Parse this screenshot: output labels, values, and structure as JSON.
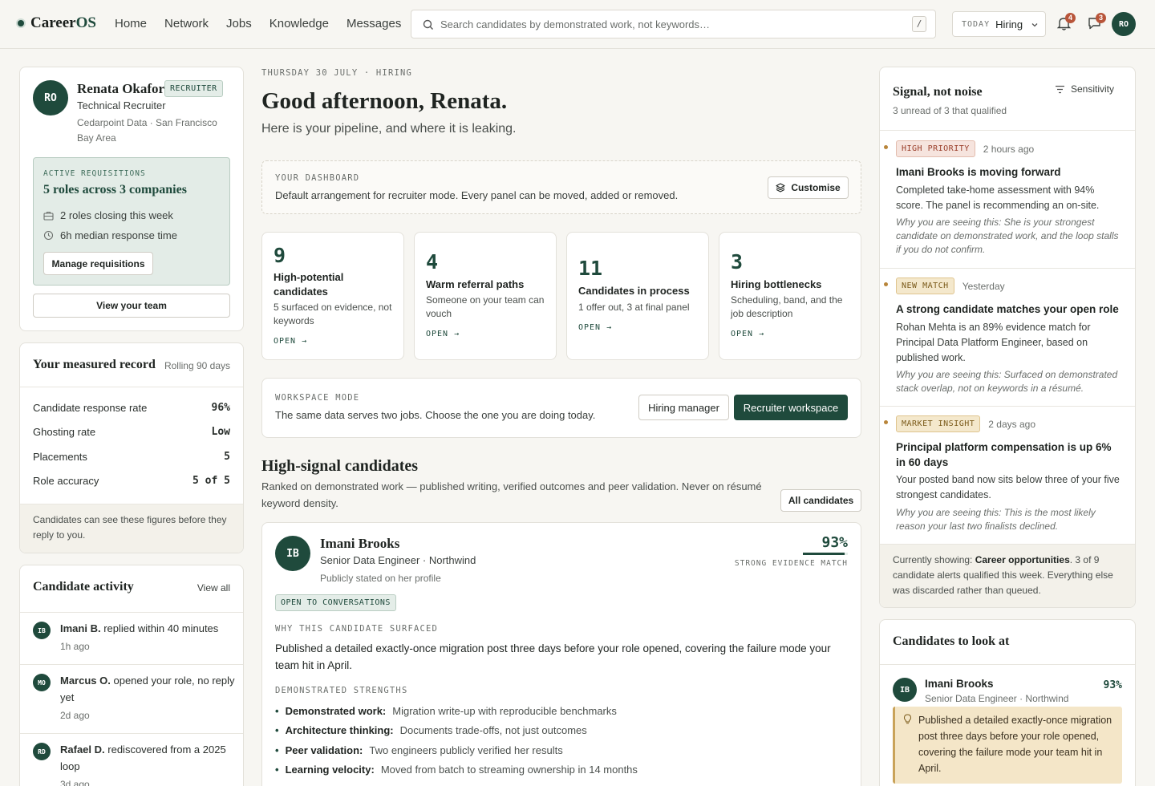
{
  "nav": {
    "logo_a": "Career",
    "logo_b": "OS",
    "links": [
      "Home",
      "Network",
      "Jobs",
      "Knowledge",
      "Messages"
    ],
    "search_placeholder": "Search candidates by demonstrated work, not keywords…",
    "search_shortcut": "/",
    "mode_label": "TODAY",
    "mode_value": "Hiring",
    "notifications_count": "4",
    "messages_count": "3",
    "user_initials": "RO"
  },
  "profile": {
    "initials": "RO",
    "name": "Renata Okafor",
    "tag": "RECRUITER",
    "role": "Technical Recruiter",
    "location": "Cedarpoint Data · San Francisco Bay Area",
    "req_label": "ACTIVE REQUISITIONS",
    "req_title": "5 roles across 3 companies",
    "req_closing": "2 roles closing this week",
    "req_response": "6h median response time",
    "manage_btn": "Manage requisitions",
    "team_btn": "View your team"
  },
  "record": {
    "title": "Your measured record",
    "period": "Rolling 90 days",
    "rows": [
      {
        "label": "Candidate response rate",
        "value": "96%"
      },
      {
        "label": "Ghosting rate",
        "value": "Low"
      },
      {
        "label": "Placements",
        "value": "5"
      },
      {
        "label": "Role accuracy",
        "value": "5 of 5"
      }
    ],
    "footnote": "Candidates can see these figures before they reply to you."
  },
  "activity": {
    "title": "Candidate activity",
    "view_all": "View all",
    "items": [
      {
        "initials": "IB",
        "name": "Imani B.",
        "text": "replied within 40 minutes",
        "time": "1h ago"
      },
      {
        "initials": "MO",
        "name": "Marcus O.",
        "text": "opened your role, no reply yet",
        "time": "2d ago"
      },
      {
        "initials": "RD",
        "name": "Rafael D.",
        "text": "rediscovered from a 2025 loop",
        "time": "3d ago"
      }
    ]
  },
  "main": {
    "kicker": "THURSDAY 30 JULY · HIRING",
    "greeting": "Good afternoon, Renata.",
    "subtitle": "Here is your pipeline, and where it is leaking.",
    "dashboard_label": "YOUR DASHBOARD",
    "dashboard_text": "Default arrangement for recruiter mode. Every panel can be moved, added or removed.",
    "customise_btn": "Customise",
    "stats": [
      {
        "num": "9",
        "title": "High-potential candidates",
        "desc": "5 surfaced on evidence, not keywords",
        "open": "OPEN →"
      },
      {
        "num": "4",
        "title": "Warm referral paths",
        "desc": "Someone on your team can vouch",
        "open": "OPEN →"
      },
      {
        "num": "11",
        "title": "Candidates in process",
        "desc": "1 offer out, 3 at final panel",
        "open": "OPEN →"
      },
      {
        "num": "3",
        "title": "Hiring bottlenecks",
        "desc": "Scheduling, band, and the job description",
        "open": "OPEN →"
      }
    ],
    "workspace_label": "WORKSPACE MODE",
    "workspace_text": "The same data serves two jobs. Choose the one you are doing today.",
    "hm_btn": "Hiring manager",
    "rw_btn": "Recruiter workspace",
    "hs_title": "High-signal candidates",
    "hs_sub": "Ranked on demonstrated work — published writing, verified outcomes and peer validation. Never on résumé keyword density.",
    "all_btn": "All candidates",
    "candidate": {
      "initials": "IB",
      "name": "Imani Brooks",
      "role": "Senior Data Engineer · Northwind",
      "note": "Publicly stated on her profile",
      "score": "93%",
      "score_value": 0.93,
      "score_label": "STRONG EVIDENCE MATCH",
      "status": "OPEN TO CONVERSATIONS",
      "why_label": "WHY THIS CANDIDATE SURFACED",
      "why_text": "Published a detailed exactly-once migration post three days before your role opened, covering the failure mode your team hit in April.",
      "strengths_label": "DEMONSTRATED STRENGTHS",
      "strengths": [
        {
          "k": "Demonstrated work:",
          "v": "Migration write-up with reproducible benchmarks"
        },
        {
          "k": "Architecture thinking:",
          "v": "Documents trade-offs, not just outcomes"
        },
        {
          "k": "Peer validation:",
          "v": "Two engineers publicly verified her results"
        },
        {
          "k": "Learning velocity:",
          "v": "Moved from batch to streaming ownership in 14 months"
        }
      ]
    }
  },
  "signals": {
    "title": "Signal, not noise",
    "sub": "3 unread of 3 that qualified",
    "sensitivity": "Sensitivity",
    "items": [
      {
        "tag": "HIGH PRIORITY",
        "time": "2 hours ago",
        "title": "Imani Brooks is moving forward",
        "body": "Completed take-home assessment with 94% score. The panel is recommending an on-site.",
        "why": "Why you are seeing this: She is your strongest candidate on demonstrated work, and the loop stalls if you do not confirm."
      },
      {
        "tag": "NEW MATCH",
        "time": "Yesterday",
        "title": "A strong candidate matches your open role",
        "body": "Rohan Mehta is an 89% evidence match for Principal Data Platform Engineer, based on published work.",
        "why": "Why you are seeing this: Surfaced on demonstrated stack overlap, not on keywords in a résumé."
      },
      {
        "tag": "MARKET INSIGHT",
        "time": "2 days ago",
        "title": "Principal platform compensation is up 6% in 60 days",
        "body": "Your posted band now sits below three of your five strongest candidates.",
        "why": "Why you are seeing this: This is the most likely reason your last two finalists declined."
      }
    ],
    "foot_a": "Currently showing: ",
    "foot_b": "Career opportunities",
    "foot_c": ". 3 of 9 candidate alerts qualified this week. Everything else was discarded rather than queued."
  },
  "look": {
    "title": "Candidates to look at",
    "initials": "IB",
    "name": "Imani Brooks",
    "role": "Senior Data Engineer · Northwind",
    "score": "93%",
    "highlight": "Published a detailed exactly-once migration post three days before your role opened, covering the failure mode your team hit in April."
  },
  "colors": {
    "accent": "#1f4a3c",
    "badge": "#b8553a",
    "highlight": "#f4e6c8"
  }
}
